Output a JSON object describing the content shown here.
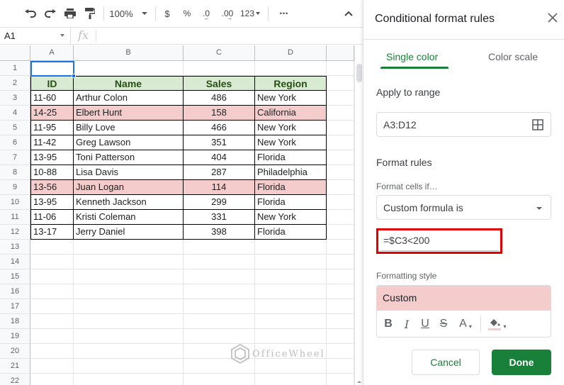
{
  "toolbar": {
    "zoom": "100%",
    "currency": "$",
    "percent": "%",
    "decrease_decimal": ".0",
    "increase_decimal": ".00",
    "more_formats": "123",
    "more": "•••"
  },
  "formula_bar": {
    "name_box": "A1",
    "fx": "fx",
    "value": ""
  },
  "grid": {
    "columns": [
      "A",
      "B",
      "C",
      "D"
    ],
    "row_numbers": [
      "1",
      "2",
      "3",
      "4",
      "5",
      "6",
      "7",
      "8",
      "9",
      "10",
      "11",
      "12",
      "13",
      "14",
      "15",
      "16",
      "17",
      "18",
      "19",
      "20",
      "21",
      "22"
    ],
    "headers": [
      "ID",
      "Name",
      "Sales",
      "Region"
    ],
    "rows": [
      {
        "id": "11-60",
        "name": "Arthur Colon",
        "sales": "486",
        "region": "New York",
        "highlighted": false
      },
      {
        "id": "14-25",
        "name": "Elbert Hunt",
        "sales": "158",
        "region": "California",
        "highlighted": true
      },
      {
        "id": "11-95",
        "name": "Billy Love",
        "sales": "466",
        "region": "New York",
        "highlighted": false
      },
      {
        "id": "11-42",
        "name": "Greg Lawson",
        "sales": "351",
        "region": "New York",
        "highlighted": false
      },
      {
        "id": "13-95",
        "name": "Toni Patterson",
        "sales": "404",
        "region": "Florida",
        "highlighted": false
      },
      {
        "id": "10-88",
        "name": "Lisa Davis",
        "sales": "287",
        "region": "Philadelphia",
        "highlighted": false
      },
      {
        "id": "13-56",
        "name": "Juan Logan",
        "sales": "114",
        "region": "Florida",
        "highlighted": true
      },
      {
        "id": "13-95",
        "name": "Kenneth Jackson",
        "sales": "299",
        "region": "Florida",
        "highlighted": false
      },
      {
        "id": "11-06",
        "name": "Kristi Coleman",
        "sales": "331",
        "region": "New York",
        "highlighted": false
      },
      {
        "id": "13-17",
        "name": "Jerry Daniel",
        "sales": "398",
        "region": "Florida",
        "highlighted": false
      }
    ],
    "selected_cell": "A1"
  },
  "colors": {
    "header_fill": "#d9ead3",
    "header_text": "#274e13",
    "highlight_fill": "#f4cccc",
    "accent_green": "#188038",
    "selection_blue": "#1a73e8",
    "annotation_red": "#e00000"
  },
  "watermark": "OfficeWheel",
  "panel": {
    "title": "Conditional format rules",
    "tabs": [
      {
        "label": "Single color",
        "active": true
      },
      {
        "label": "Color scale",
        "active": false
      }
    ],
    "apply_to_range_label": "Apply to range",
    "range_value": "A3:D12",
    "format_rules_label": "Format rules",
    "format_cells_if_label": "Format cells if…",
    "condition_selected": "Custom formula is",
    "formula_value": "=$C3<200",
    "formatting_style_label": "Formatting style",
    "style_preview": "Custom",
    "style_tools": [
      "bold",
      "italic",
      "underline",
      "strikethrough",
      "text-color",
      "fill-color"
    ],
    "cancel_label": "Cancel",
    "done_label": "Done"
  }
}
